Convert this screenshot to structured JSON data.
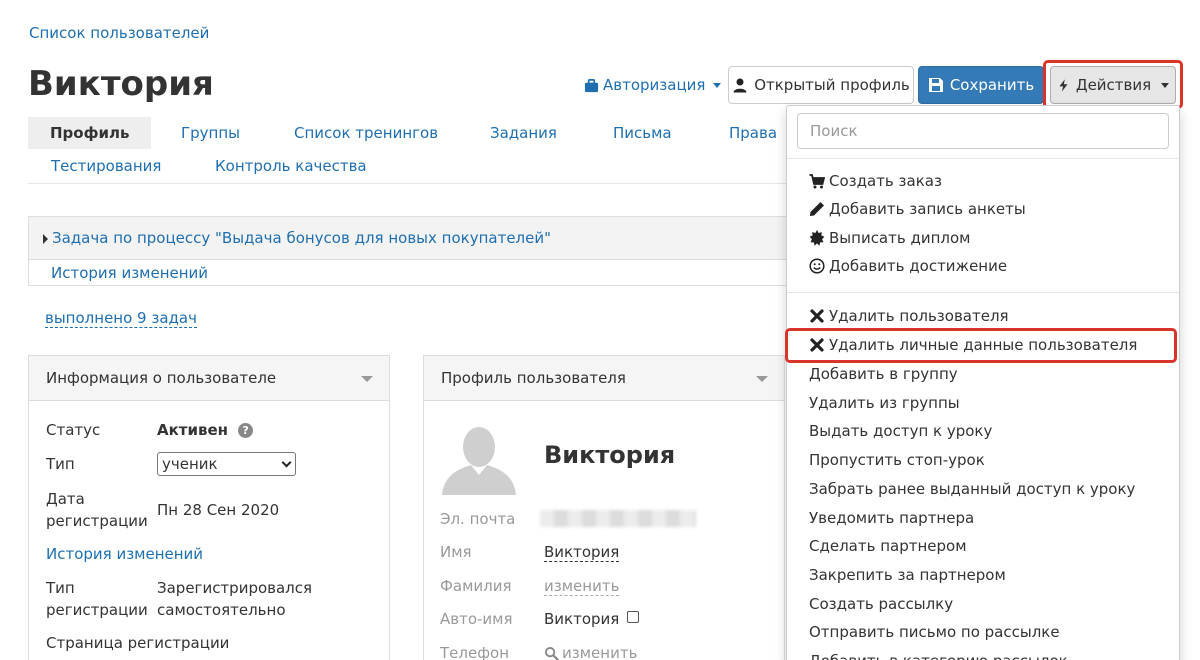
{
  "breadcrumb": "Список пользователей",
  "title": "Виктория",
  "toolbar": {
    "auth_label": "Авторизация",
    "open_profile_label": "Открытый профиль",
    "save_label": "Сохранить",
    "actions_label": "Действия"
  },
  "tabs": [
    "Профиль",
    "Группы",
    "Список тренингов",
    "Задания",
    "Письма",
    "Права",
    "Тестирования",
    "Контроль качества"
  ],
  "task": {
    "title": "Задача по процессу \"Выдача бонусов для новых покупателей\"",
    "history": "История изменений"
  },
  "done_tasks": "выполнено 9 задач",
  "user_info": {
    "title": "Информация о пользователе",
    "status_label": "Статус",
    "status_value": "Активен",
    "type_label": "Тип",
    "type_value": "ученик",
    "reg_date_label_1": "Дата",
    "reg_date_label_2": "регистрации",
    "reg_date_value": "Пн 28 Сен 2020",
    "history": "История изменений",
    "reg_type_label_1": "Тип",
    "reg_type_label_2": "регистрации",
    "reg_type_value_1": "Зарегистрировался",
    "reg_type_value_2": "самостоятельно",
    "reg_page_label": "Страница регистрации"
  },
  "profile": {
    "title": "Профиль пользователя",
    "name": "Виктория",
    "email_label": "Эл. почта",
    "first_name_label": "Имя",
    "first_name_value": "Виктория",
    "last_name_label": "Фамилия",
    "last_name_value": "изменить",
    "auto_name_label": "Авто-имя",
    "auto_name_value": "Виктория",
    "phone_label": "Телефон",
    "phone_value": "изменить"
  },
  "actions_menu": {
    "search_placeholder": "Поиск",
    "group1": [
      {
        "icon": "cart-icon",
        "label": "Создать заказ"
      },
      {
        "icon": "pencil-icon",
        "label": "Добавить запись анкеты"
      },
      {
        "icon": "certificate-icon",
        "label": "Выписать диплом"
      },
      {
        "icon": "smile-icon",
        "label": "Добавить достижение"
      }
    ],
    "group2": [
      {
        "icon": "remove-icon",
        "label": "Удалить пользователя"
      },
      {
        "icon": "remove-icon",
        "label": "Удалить личные данные пользователя"
      },
      {
        "label": "Добавить в группу"
      },
      {
        "label": "Удалить из группы"
      },
      {
        "label": "Выдать доступ к уроку"
      },
      {
        "label": "Пропустить стоп-урок"
      },
      {
        "label": "Забрать ранее выданный доступ к уроку"
      },
      {
        "label": "Уведомить партнера"
      },
      {
        "label": "Сделать партнером"
      },
      {
        "label": "Закрепить за партнером"
      },
      {
        "label": "Создать рассылку"
      },
      {
        "label": "Отправить письмо по рассылке"
      },
      {
        "label": "Добавить в категорию рассылок"
      }
    ]
  },
  "colors": {
    "link": "#1f6fb0",
    "primary": "#337ab7",
    "highlight": "#d9342b"
  }
}
